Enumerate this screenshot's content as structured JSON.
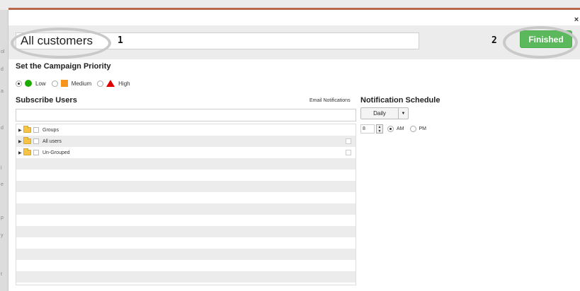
{
  "modal": {
    "close_glyph": "×",
    "campaign_name": "All customers",
    "callouts": [
      "1",
      "2"
    ],
    "finished_label": "Finished"
  },
  "priority": {
    "title": "Set the Campaign Priority",
    "options": [
      {
        "label": "Low",
        "selected": true,
        "color": "#1faa00",
        "icon": "green-circle-icon"
      },
      {
        "label": "Medium",
        "selected": false,
        "color": "#f7941d",
        "icon": "orange-square-icon"
      },
      {
        "label": "High",
        "selected": false,
        "color": "#e00000",
        "icon": "red-triangle-icon"
      }
    ]
  },
  "subscribe": {
    "title": "Subscribe Users",
    "search_value": "",
    "tree": [
      {
        "label": "Groups"
      },
      {
        "label": "All users"
      },
      {
        "label": "Un-Grouped"
      }
    ]
  },
  "notifications": {
    "email_label": "Email Notifications",
    "schedule_title": "Notification Schedule",
    "frequency": "Daily",
    "hour": "8",
    "am_label": "AM",
    "pm_label": "PM",
    "selected_period": "AM"
  },
  "colors": {
    "accent_green": "#5cb85c",
    "brand_bar": "#b9694a"
  }
}
